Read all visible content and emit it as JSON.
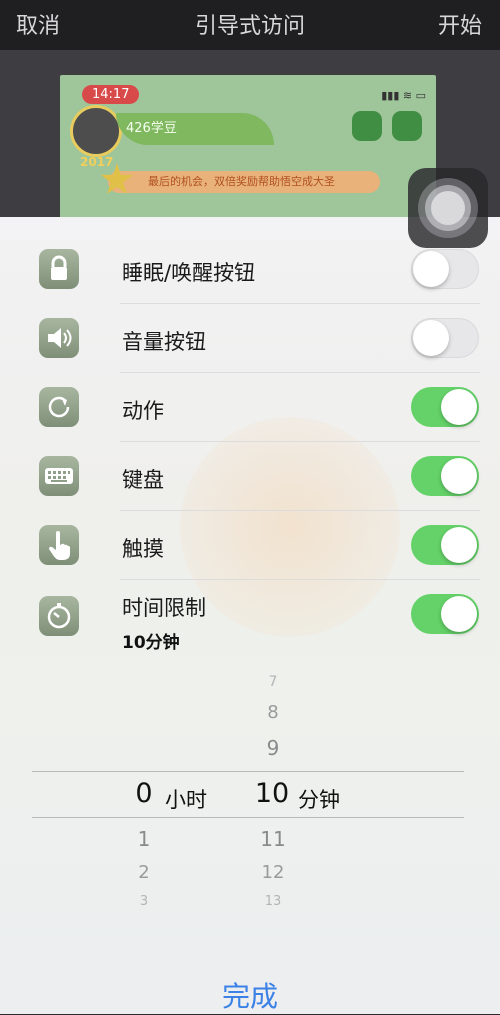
{
  "topbar": {
    "cancel": "取消",
    "title": "引导式访问",
    "start": "开始"
  },
  "preview": {
    "time": "14:17",
    "leaf_text": "426学豆",
    "banner": "最后的机会，双倍奖励帮助悟空成大圣",
    "year": "2017"
  },
  "options": [
    {
      "label": "睡眠/唤醒按钮",
      "on": false,
      "icon": "lock-icon"
    },
    {
      "label": "音量按钮",
      "on": false,
      "icon": "speaker-icon"
    },
    {
      "label": "动作",
      "on": true,
      "icon": "rotate-icon"
    },
    {
      "label": "键盘",
      "on": true,
      "icon": "keyboard-icon"
    },
    {
      "label": "触摸",
      "on": true,
      "icon": "touch-hand-icon"
    },
    {
      "label": "时间限制",
      "on": true,
      "icon": "timer-icon",
      "value": "10分钟"
    }
  ],
  "picker": {
    "hours": {
      "above": [
        "",
        "",
        ""
      ],
      "selected": "0",
      "below": [
        "1",
        "2",
        "3"
      ],
      "unit": "小时"
    },
    "minutes": {
      "above": [
        "7",
        "8",
        "9"
      ],
      "selected": "10",
      "below": [
        "11",
        "12",
        "13"
      ],
      "unit": "分钟"
    }
  },
  "done_label": "完成",
  "colors": {
    "toggle_on": "#64d268",
    "accent": "#3c82e6"
  }
}
